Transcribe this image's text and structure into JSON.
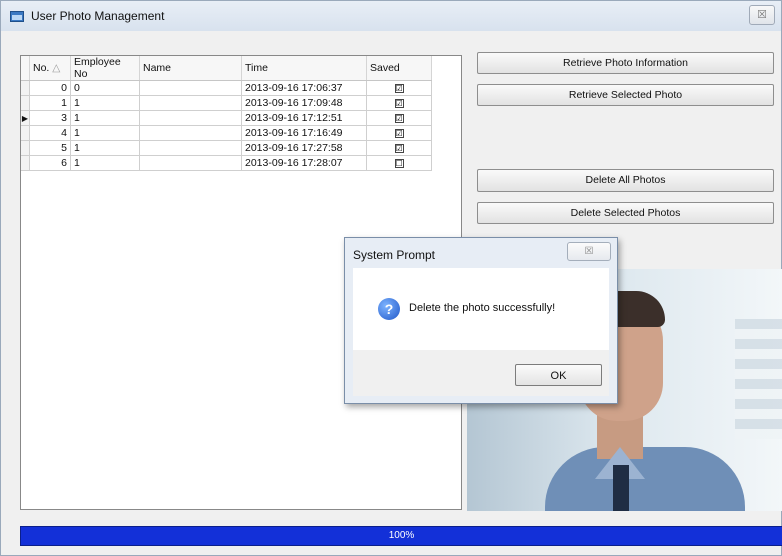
{
  "window": {
    "title": "User Photo Management",
    "close_label": "☒"
  },
  "grid": {
    "columns": [
      "No.",
      "Employee No",
      "Name",
      "Time",
      "Saved"
    ],
    "sort_indicator": "△",
    "rows": [
      {
        "no": "0",
        "employee_no": "0",
        "name": "",
        "time": "2013-09-16 17:06:37",
        "saved": "☑",
        "current": ""
      },
      {
        "no": "1",
        "employee_no": "1",
        "name": "",
        "time": "2013-09-16 17:09:48",
        "saved": "☑",
        "current": ""
      },
      {
        "no": "3",
        "employee_no": "1",
        "name": "",
        "time": "2013-09-16 17:12:51",
        "saved": "☑",
        "current": "▶"
      },
      {
        "no": "4",
        "employee_no": "1",
        "name": "",
        "time": "2013-09-16 17:16:49",
        "saved": "☑",
        "current": ""
      },
      {
        "no": "5",
        "employee_no": "1",
        "name": "",
        "time": "2013-09-16 17:27:58",
        "saved": "☑",
        "current": ""
      },
      {
        "no": "6",
        "employee_no": "1",
        "name": "",
        "time": "2013-09-16 17:28:07",
        "saved": "☐",
        "current": ""
      }
    ]
  },
  "buttons": {
    "retrieve_info": "Retrieve Photo Information",
    "retrieve_selected": "Retrieve Selected Photo",
    "delete_all": "Delete All Photos",
    "delete_selected": "Delete Selected Photos"
  },
  "progress": {
    "value_percent": 100,
    "label": "100%"
  },
  "dialog": {
    "title": "System Prompt",
    "close_label": "☒",
    "icon": "question-icon",
    "message": "Delete the photo successfully!",
    "ok_label": "OK"
  },
  "colors": {
    "progress_fill": "#1330d8",
    "title_bar": "#dfe7f1"
  }
}
